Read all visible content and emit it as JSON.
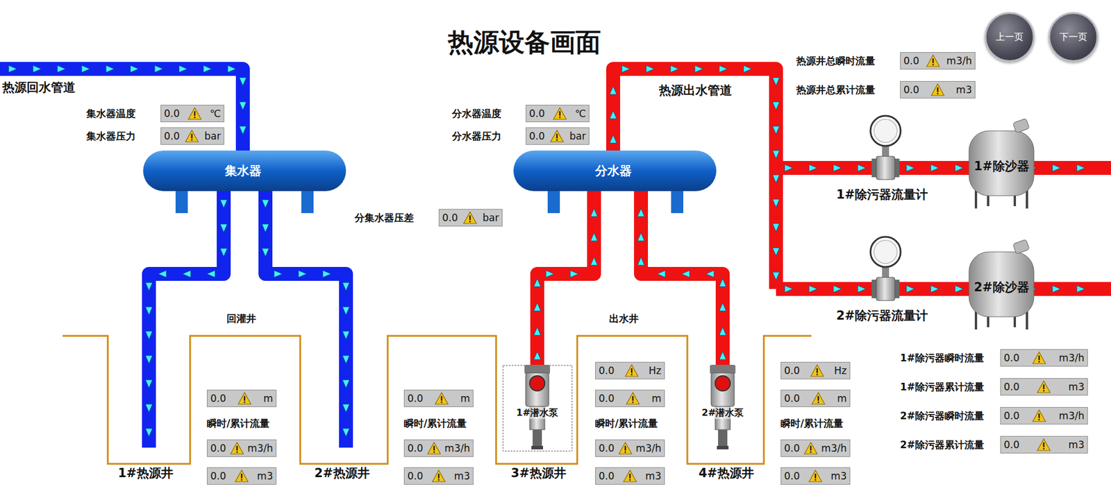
{
  "title": "热源设备画面",
  "nav": [
    {
      "label": "上一页"
    },
    {
      "label": "下一页"
    }
  ],
  "pipes": {
    "return": "热源回水管道",
    "supply": "热源出水管道"
  },
  "collector": {
    "name": "集水器",
    "readings": [
      {
        "label": "集水器温度",
        "value": "0.0",
        "unit": "℃",
        "alarm": true
      },
      {
        "label": "集水器压力",
        "value": "0.0",
        "unit": "bar",
        "alarm": true
      }
    ]
  },
  "distributor": {
    "name": "分水器",
    "readings": [
      {
        "label": "分水器温度",
        "value": "0.0",
        "unit": "℃",
        "alarm": true
      },
      {
        "label": "分水器压力",
        "value": "0.0",
        "unit": "bar",
        "alarm": true
      }
    ]
  },
  "pressure_diff": {
    "label": "分集水器压差",
    "value": "0.0",
    "unit": "bar",
    "alarm": true
  },
  "well_groups": [
    "回灌井",
    "出水井"
  ],
  "wells": [
    {
      "name": "1#热源井",
      "readings": [
        {
          "value": "0.0",
          "unit": "m",
          "alarm": true
        }
      ],
      "flow_label": "瞬时/累计流量",
      "flows": [
        {
          "value": "0.0",
          "unit": "m3/h",
          "alarm": true
        },
        {
          "value": "0.0",
          "unit": "m3",
          "alarm": true
        }
      ]
    },
    {
      "name": "2#热源井",
      "readings": [
        {
          "value": "0.0",
          "unit": "m",
          "alarm": true
        }
      ],
      "flow_label": "瞬时/累计流量",
      "flows": [
        {
          "value": "0.0",
          "unit": "m3/h",
          "alarm": true
        },
        {
          "value": "0.0",
          "unit": "m3",
          "alarm": true
        }
      ]
    },
    {
      "name": "3#热源井",
      "readings": [
        {
          "value": "0.0",
          "unit": "Hz",
          "alarm": true
        },
        {
          "value": "0.0",
          "unit": "m",
          "alarm": true
        }
      ],
      "flow_label": "瞬时/累计流量",
      "flows": [
        {
          "value": "0.0",
          "unit": "m3/h",
          "alarm": true
        },
        {
          "value": "0.0",
          "unit": "m3",
          "alarm": true
        }
      ]
    },
    {
      "name": "4#热源井",
      "readings": [
        {
          "value": "0.0",
          "unit": "Hz",
          "alarm": true
        },
        {
          "value": "0.0",
          "unit": "m",
          "alarm": true
        }
      ],
      "flow_label": "瞬时/累计流量",
      "flows": [
        {
          "value": "0.0",
          "unit": "m3/h",
          "alarm": true
        },
        {
          "value": "0.0",
          "unit": "m3",
          "alarm": true
        }
      ]
    }
  ],
  "pumps": [
    {
      "name": "1#潜水泵",
      "selected": true,
      "running": false
    },
    {
      "name": "2#潜水泵",
      "selected": false,
      "running": false
    }
  ],
  "totals": [
    {
      "label": "热源井总瞬时流量",
      "value": "0.0",
      "unit": "m3/h",
      "alarm": true
    },
    {
      "label": "热源井总累计流量",
      "value": "0.0",
      "unit": "m3",
      "alarm": true
    }
  ],
  "filters": [
    {
      "meter": "1#除污器流量计",
      "sand": "1#除沙器"
    },
    {
      "meter": "2#除污器流量计",
      "sand": "2#除沙器"
    }
  ],
  "filter_readings": [
    {
      "label": "1#除污器瞬时流量",
      "value": "0.0",
      "unit": "m3/h",
      "alarm": true
    },
    {
      "label": "1#除污器累计流量",
      "value": "0.0",
      "unit": "m3",
      "alarm": true
    },
    {
      "label": "2#除污器瞬时流量",
      "value": "0.0",
      "unit": "m3/h",
      "alarm": true
    },
    {
      "label": "2#除污器累计流量",
      "value": "0.0",
      "unit": "m3",
      "alarm": true
    }
  ]
}
